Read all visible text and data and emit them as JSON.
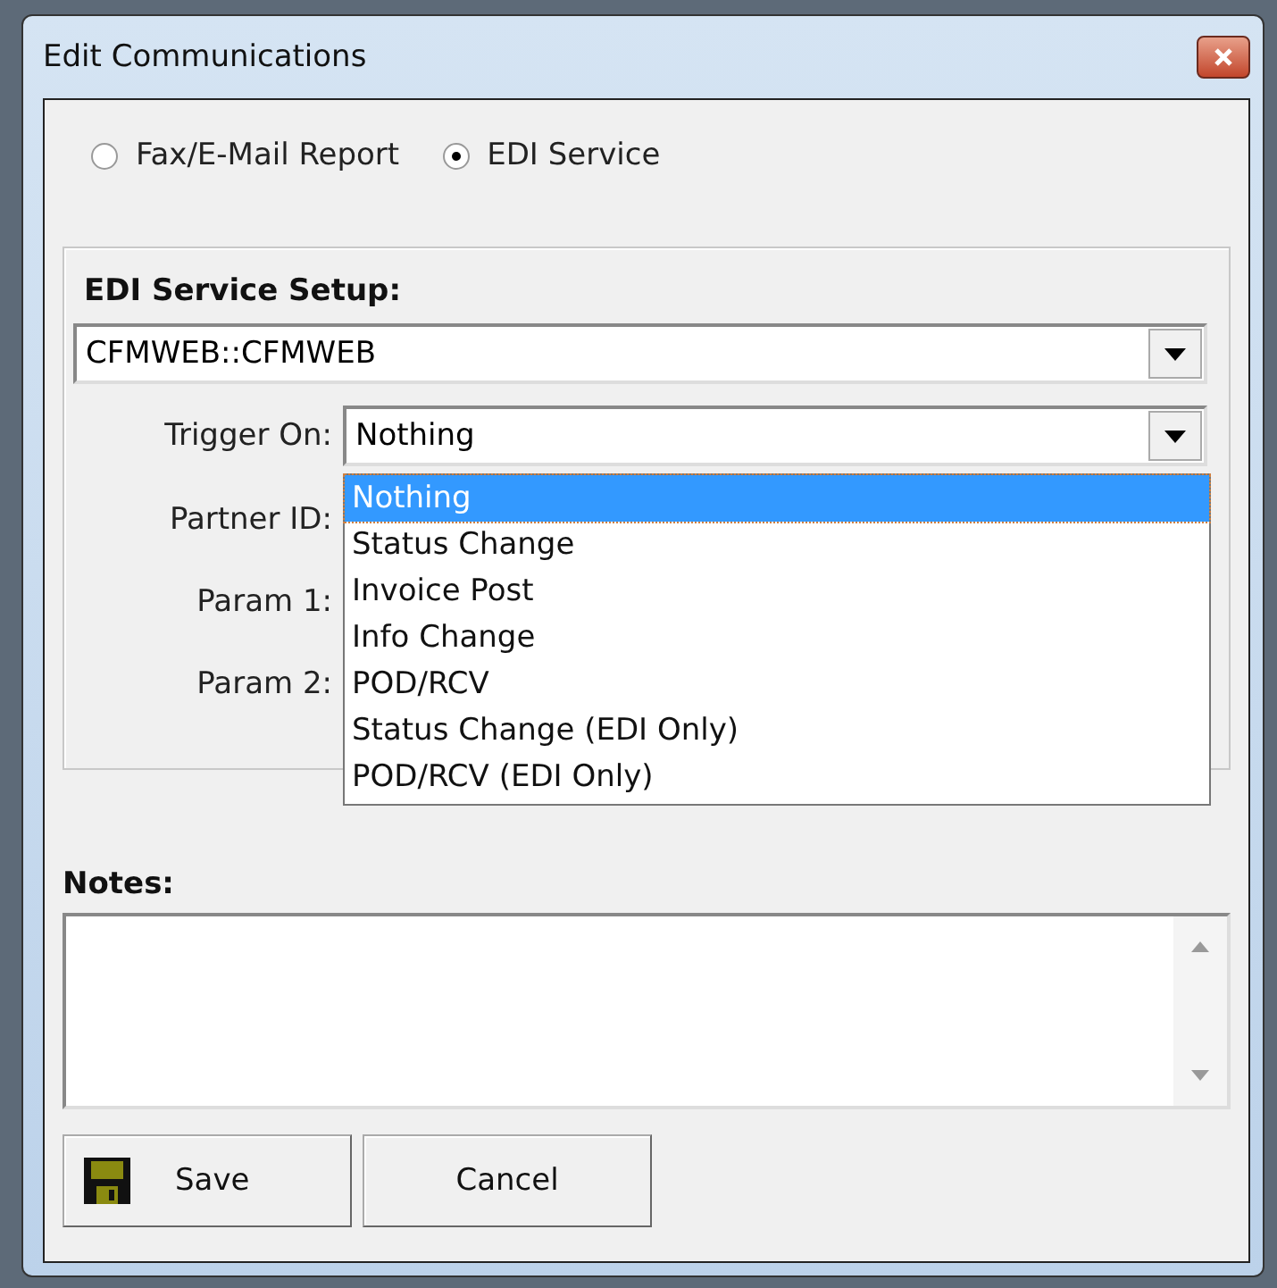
{
  "window": {
    "title": "Edit Communications"
  },
  "report_type": [
    {
      "label": "Fax/E-Mail Report",
      "selected": false
    },
    {
      "label": "EDI Service",
      "selected": true
    }
  ],
  "setup": {
    "heading": "EDI Service Setup:",
    "service": "CFMWEB::CFMWEB",
    "trigger_label": "Trigger On:",
    "trigger_value": "Nothing",
    "trigger_options": [
      {
        "label": "Nothing",
        "selected": true
      },
      {
        "label": "Status Change",
        "selected": false
      },
      {
        "label": "Invoice Post",
        "selected": false
      },
      {
        "label": "Info Change",
        "selected": false
      },
      {
        "label": "POD/RCV",
        "selected": false
      },
      {
        "label": "Status Change (EDI Only)",
        "selected": false
      },
      {
        "label": "POD/RCV (EDI Only)",
        "selected": false
      }
    ],
    "fields": [
      "Partner ID:",
      "Param 1:",
      "Param 2:"
    ]
  },
  "notes": {
    "label": "Notes:"
  },
  "buttons": [
    {
      "kind": "save",
      "label": "Save"
    },
    {
      "kind": "cancel",
      "label": "Cancel"
    }
  ]
}
